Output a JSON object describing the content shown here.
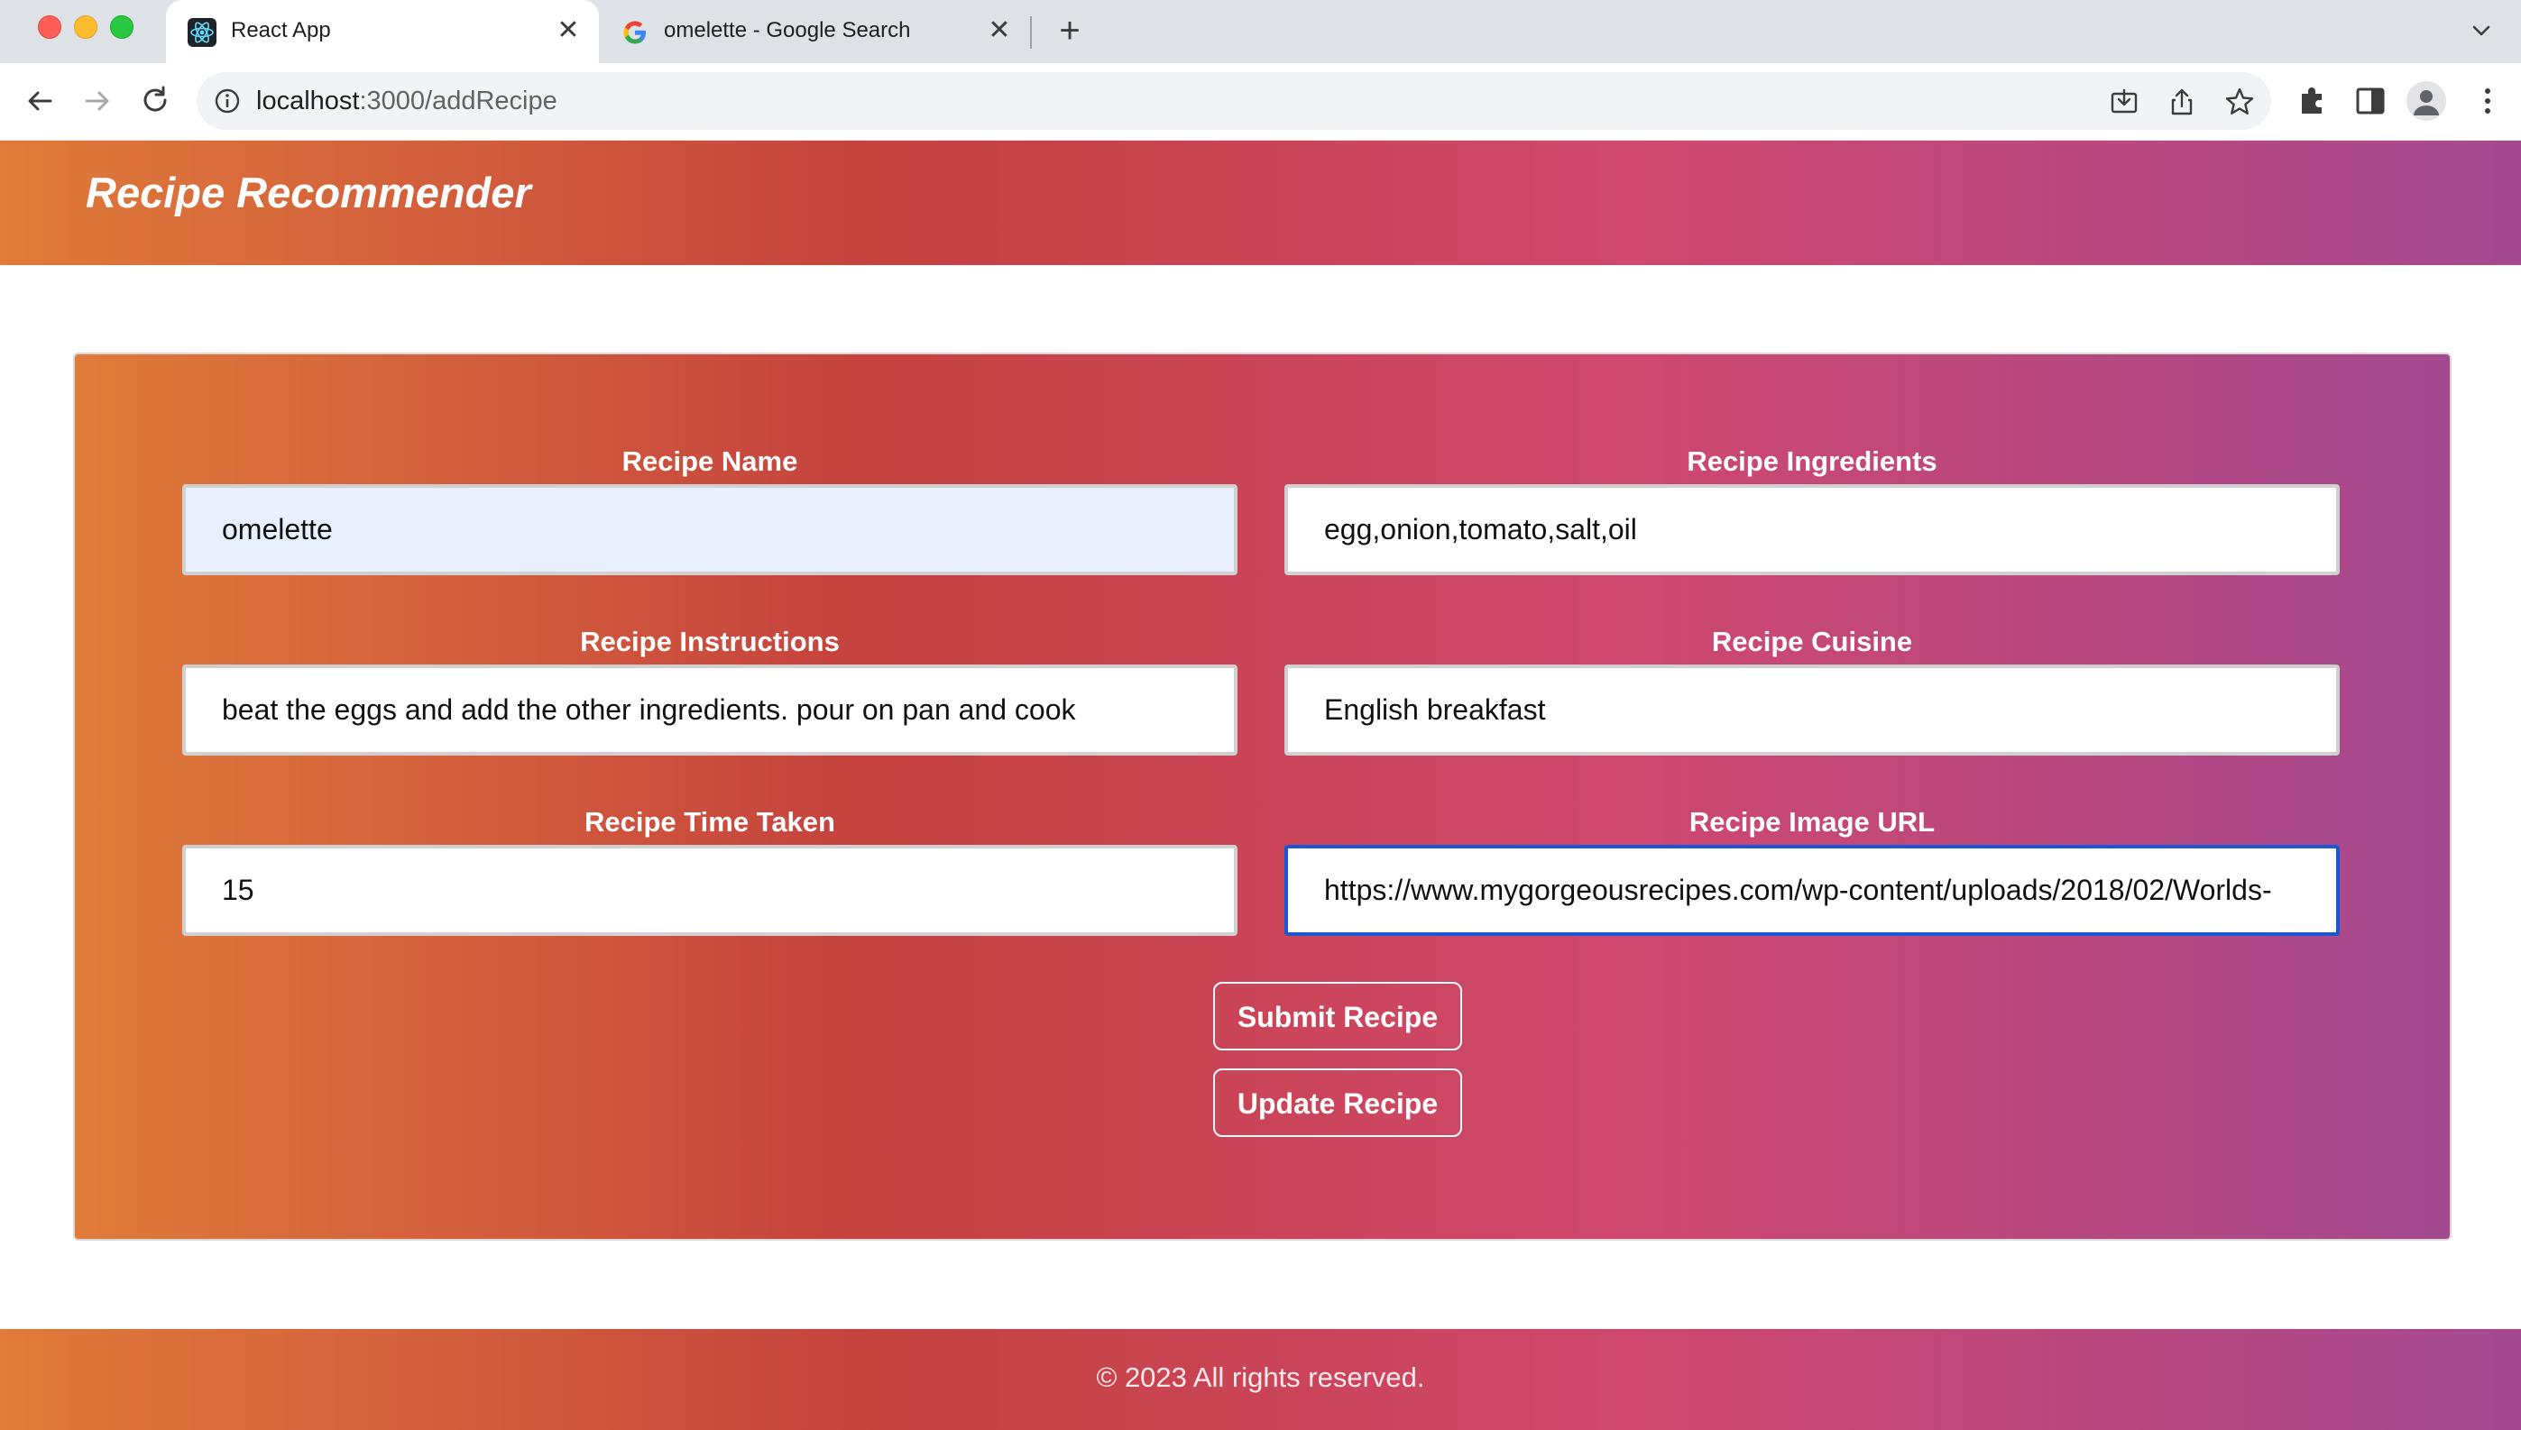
{
  "browser": {
    "tabs": [
      {
        "title": "React App",
        "active": true,
        "icon": "react-logo-icon"
      },
      {
        "title": "omelette - Google Search",
        "active": false,
        "icon": "google-g-icon"
      }
    ],
    "url_host": "localhost",
    "url_rest": ":3000/addRecipe"
  },
  "app": {
    "title": "Recipe Recommender",
    "form": {
      "recipe_name": {
        "label": "Recipe Name",
        "value": "omelette"
      },
      "recipe_ingredients": {
        "label": "Recipe Ingredients",
        "value": "egg,onion,tomato,salt,oil"
      },
      "recipe_instructions": {
        "label": "Recipe Instructions",
        "value": "beat the eggs and add the other ingredients. pour on pan and cook"
      },
      "recipe_cuisine": {
        "label": "Recipe Cuisine",
        "value": "English breakfast"
      },
      "recipe_time": {
        "label": "Recipe Time Taken",
        "value": "15"
      },
      "recipe_image": {
        "label": "Recipe Image URL",
        "value": "https://www.mygorgeousrecipes.com/wp-content/uploads/2018/02/Worlds-"
      }
    },
    "buttons": {
      "submit": "Submit Recipe",
      "update": "Update Recipe"
    },
    "footer": "© 2023 All rights reserved."
  },
  "colors": {
    "gradient_start": "#e07b39",
    "gradient_mid": "#c5423e",
    "gradient_pink": "#cf476e",
    "gradient_end": "#a4498f",
    "focus_border": "#1a56d6",
    "autofill_bg": "#e8f0fe"
  }
}
